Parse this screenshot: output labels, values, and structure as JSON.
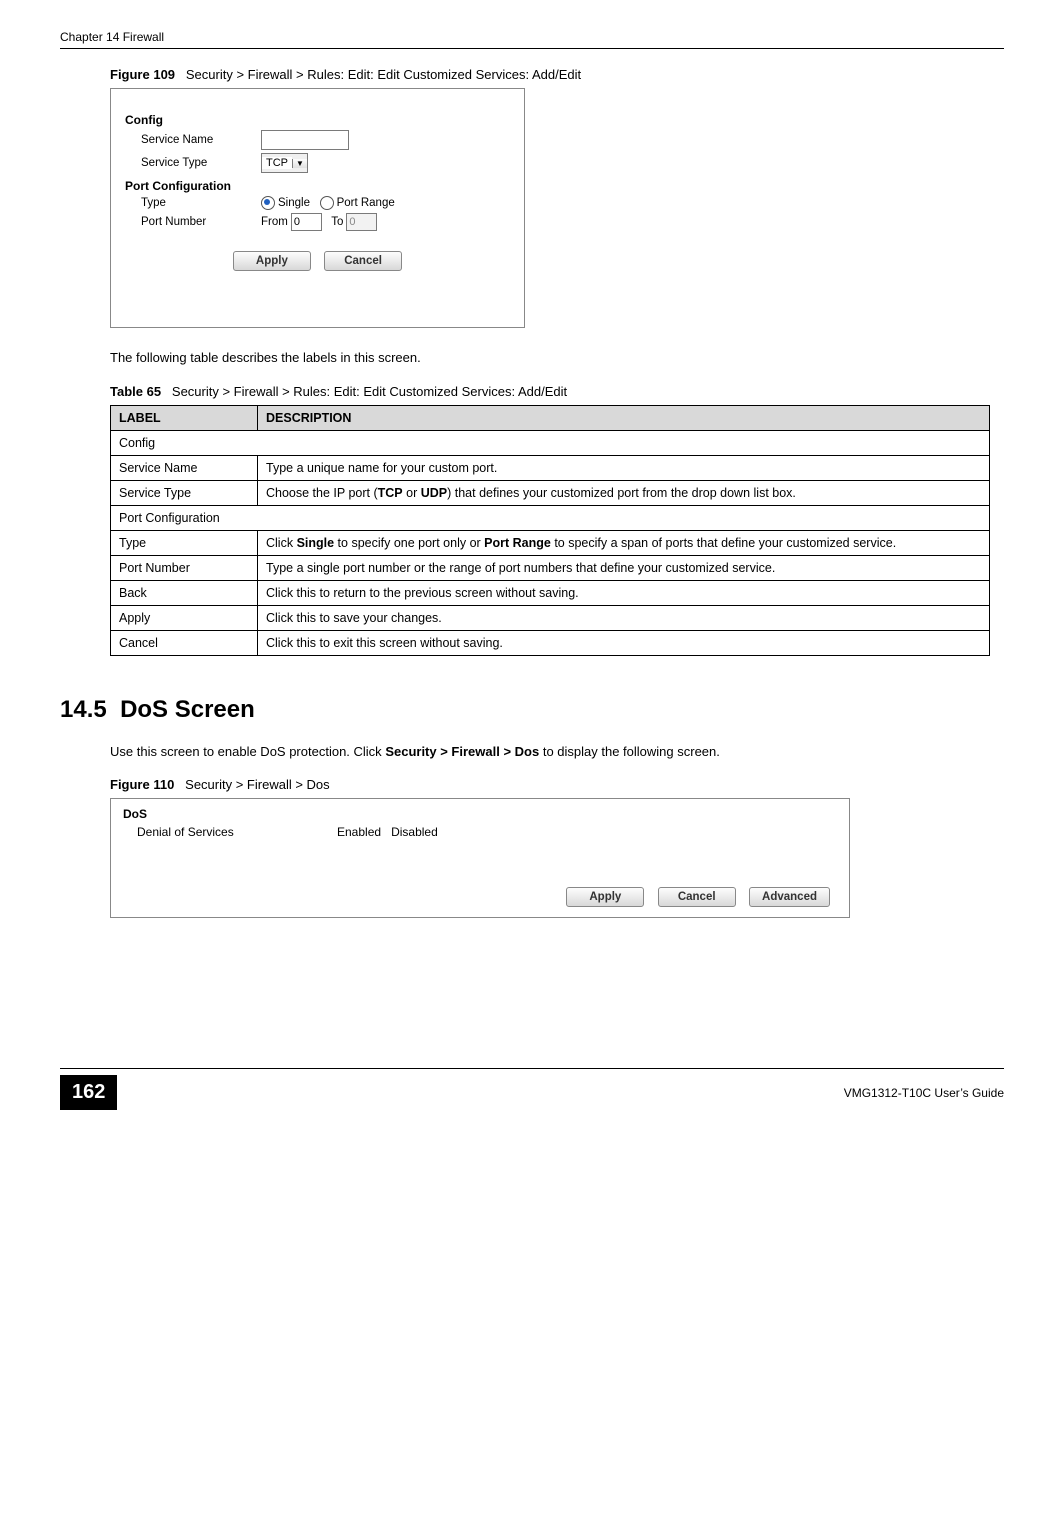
{
  "header": {
    "chapter": "Chapter 14 Firewall"
  },
  "figure109": {
    "caption_prefix": "Figure 109",
    "caption_text": "Security > Firewall > Rules: Edit: Edit Customized Services: Add/Edit",
    "config_label": "Config",
    "service_name_label": "Service Name",
    "service_type_label": "Service Type",
    "service_type_value": "TCP",
    "port_config_label": "Port Configuration",
    "type_label": "Type",
    "radio_single": "Single",
    "radio_range": "Port Range",
    "port_number_label": "Port Number",
    "from_label": "From",
    "from_value": "0",
    "to_label": "To",
    "to_value": "0",
    "apply_btn": "Apply",
    "cancel_btn": "Cancel"
  },
  "para1": "The following table describes the labels in this screen.",
  "table65": {
    "caption_prefix": "Table 65",
    "caption_text": "Security > Firewall > Rules: Edit: Edit Customized Services: Add/Edit",
    "col_label": "LABEL",
    "col_desc": "DESCRIPTION",
    "rows": [
      {
        "label": "Config",
        "desc": "",
        "span": true
      },
      {
        "label": "Service Name",
        "desc": "Type a unique name for your custom port."
      },
      {
        "label": "Service Type",
        "desc_pre": "Choose the IP port (",
        "desc_b1": "TCP",
        "desc_mid": " or ",
        "desc_b2": "UDP",
        "desc_post": ") that defines your customized port from the drop down list box."
      },
      {
        "label": "Port Configuration",
        "desc": "",
        "span": true
      },
      {
        "label": "Type",
        "desc_pre": "Click ",
        "desc_b1": "Single",
        "desc_mid": " to specify one port only or ",
        "desc_b2": "Port Range",
        "desc_post": " to specify a span of ports that define your customized service."
      },
      {
        "label": "Port Number",
        "desc": "Type a single port number or the range of port numbers that define your customized service."
      },
      {
        "label": "Back",
        "desc": "Click this to return to the previous screen without saving."
      },
      {
        "label": "Apply",
        "desc": "Click this to save your changes."
      },
      {
        "label": "Cancel",
        "desc": "Click this to exit this screen without saving."
      }
    ]
  },
  "section145": {
    "number": "14.5",
    "title": "DoS Screen",
    "para_pre": "Use this screen to enable DoS protection. Click ",
    "para_bold": "Security > Firewall > Dos",
    "para_post": " to display the following screen."
  },
  "figure110": {
    "caption_prefix": "Figure 110",
    "caption_text": "Security > Firewall > Dos",
    "dos_label": "DoS",
    "denial_label": "Denial of Services",
    "enabled_label": "Enabled",
    "disabled_label": "Disabled",
    "apply_btn": "Apply",
    "cancel_btn": "Cancel",
    "advanced_btn": "Advanced"
  },
  "footer": {
    "page": "162",
    "guide": "VMG1312-T10C User’s Guide"
  }
}
